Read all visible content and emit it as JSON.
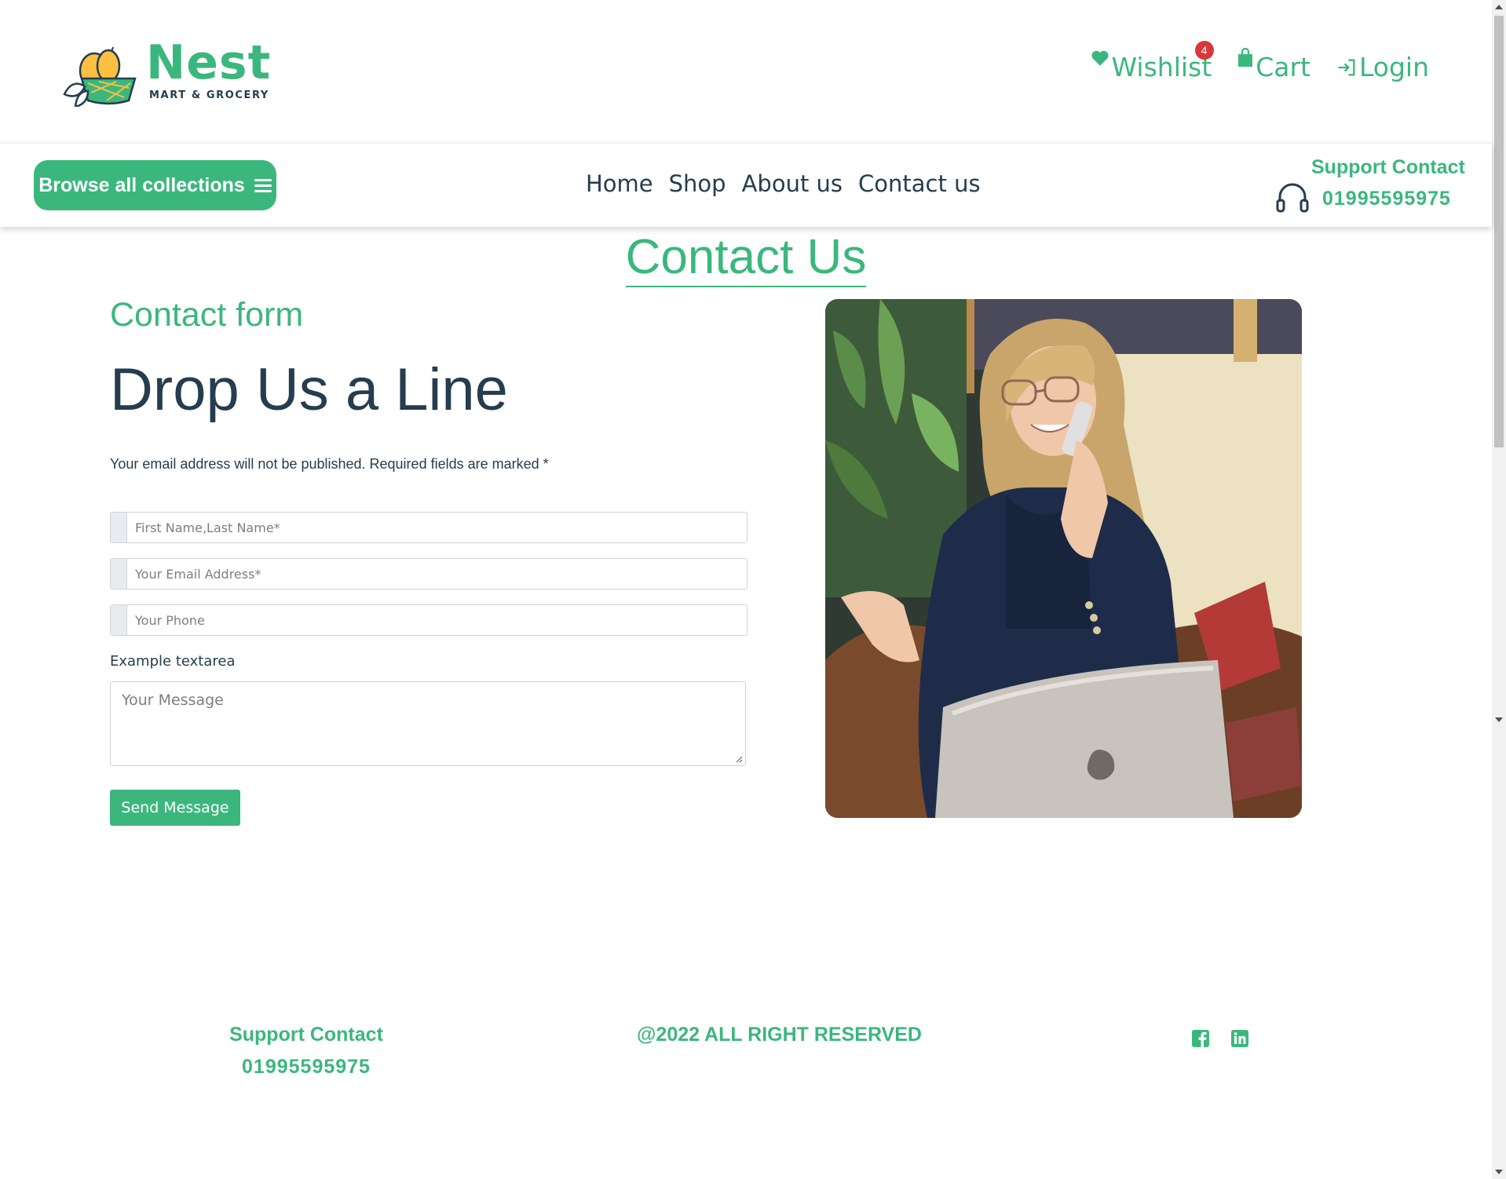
{
  "brand": {
    "name": "Nest",
    "tagline": "MART & GROCERY",
    "color": "#3BB77E"
  },
  "header": {
    "wishlist": {
      "label": "Wishlist",
      "count": "4",
      "icon": "heart-icon"
    },
    "cart": {
      "label": "Cart",
      "icon": "shopping-bag-icon"
    },
    "login": {
      "label": "Login",
      "icon": "login-icon"
    }
  },
  "nav": {
    "browse_label": "Browse all collections",
    "items": [
      {
        "label": "Home"
      },
      {
        "label": "Shop"
      },
      {
        "label": "About us"
      },
      {
        "label": "Contact us"
      }
    ],
    "support": {
      "label": "Support Contact",
      "phone": "01995595975",
      "icon": "headphones-icon"
    }
  },
  "main": {
    "title": "Contact Us",
    "form": {
      "kicker": "Contact form",
      "heading": "Drop Us a Line",
      "note": "Your email address will not be published. Required fields are marked *",
      "name_placeholder": "First Name,Last Name*",
      "email_placeholder": "Your Email Address*",
      "phone_placeholder": "Your Phone",
      "textarea_label": "Example textarea",
      "message_placeholder": "Your Message",
      "submit_label": "Send Message"
    }
  },
  "footer": {
    "support_label": "Support Contact",
    "support_phone": "01995595975",
    "copyright": "@2022 ALL RIGHT RESERVED",
    "social": [
      {
        "icon": "facebook-icon"
      },
      {
        "icon": "linkedin-icon"
      }
    ]
  }
}
